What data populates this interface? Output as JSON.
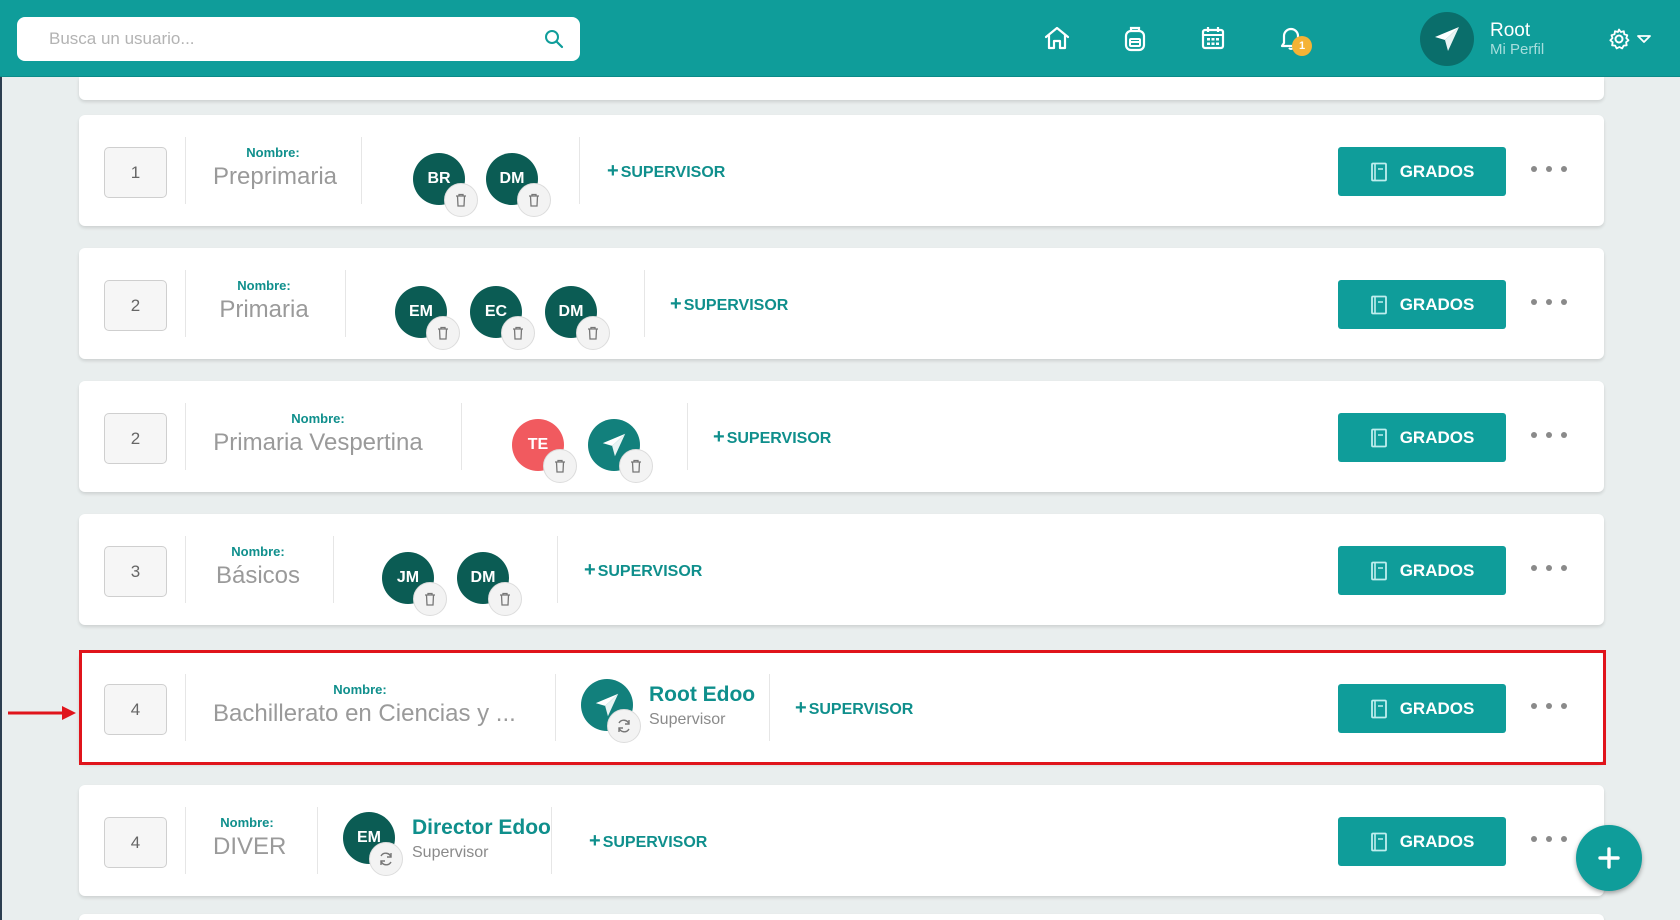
{
  "header": {
    "search_placeholder": "Busca un usuario...",
    "notifications_count": "1",
    "profile_name": "Root",
    "profile_sub": "Mi Perfil"
  },
  "colors": {
    "primary": "#0f9d9a",
    "dark_avatar": "#0b5c54",
    "red_avatar": "#f15a5f",
    "highlight": "#e0141b",
    "badge": "#f5b335"
  },
  "icons": [
    "search-icon",
    "home-icon",
    "backpack-icon",
    "calendar-icon",
    "bell-icon",
    "paper-plane-icon",
    "gear-icon",
    "chevron-down-icon",
    "trash-icon",
    "sync-icon",
    "book-icon",
    "more-icon",
    "plus-icon",
    "arrow-icon"
  ],
  "labels": {
    "name_label": "Nombre:",
    "add_supervisor": "SUPERVISOR",
    "plus": "+",
    "grados": "GRADOS"
  },
  "levels": [
    {
      "order": "1",
      "name": "Preprimaria",
      "supervisors": [
        "BR",
        "DM"
      ]
    },
    {
      "order": "2",
      "name": "Primaria",
      "supervisors": [
        "EM",
        "EC",
        "DM"
      ]
    },
    {
      "order": "2",
      "name": "Primaria Vespertina",
      "supervisors": [
        "TE",
        "paper-plane"
      ]
    },
    {
      "order": "3",
      "name": "Básicos",
      "supervisors": [
        "JM",
        "DM"
      ]
    },
    {
      "order": "4",
      "name": "Bachillerato en Ciencias y ...",
      "supervisor_name": "Root Edoo",
      "supervisor_role": "Supervisor"
    },
    {
      "order": "4",
      "name": "DIVER",
      "supervisor_initials": "EM",
      "supervisor_name": "Director Edoo",
      "supervisor_role": "Supervisor"
    }
  ]
}
